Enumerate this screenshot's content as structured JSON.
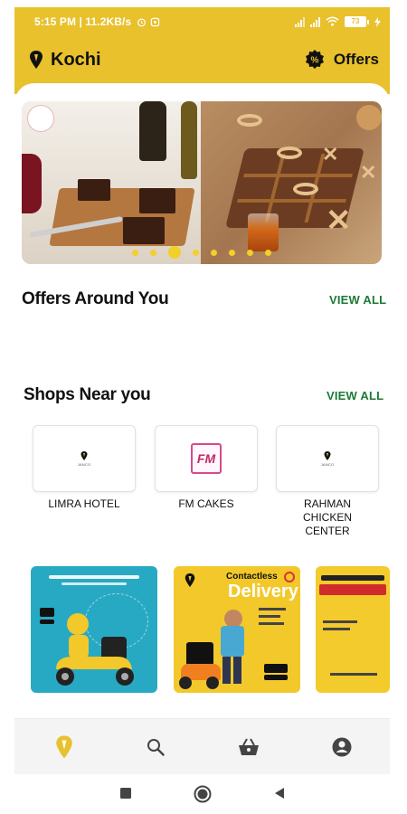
{
  "status_bar": {
    "text": "5:15 PM | 11.2KB/s",
    "battery": "73"
  },
  "app_bar": {
    "location": "Kochi",
    "offers_label": "Offers"
  },
  "banner": {
    "slide_count": 8,
    "active_slide": 3
  },
  "offers_section": {
    "title": "Offers Around You",
    "view_all": "VIEW ALL"
  },
  "shops_section": {
    "title": "Shops Near you",
    "view_all": "VIEW ALL",
    "shops": [
      {
        "name": "LIMRA HOTEL",
        "logo": "janco-logo"
      },
      {
        "name": "FM CAKES",
        "logo": "fm-cakes-logo",
        "logo_text": "FM"
      },
      {
        "name": "RAHMAN CHICKEN CENTER",
        "logo": "janco-logo"
      }
    ]
  },
  "promos": {
    "promo2_top": "Contactless",
    "promo2_headline": "Delivery"
  },
  "bottom_nav": [
    "home-icon",
    "search-icon",
    "basket-icon",
    "account-icon"
  ],
  "colors": {
    "brand_yellow": "#e8c12d",
    "view_all_green": "#1d7a36",
    "promo_teal": "#28a9c3"
  }
}
